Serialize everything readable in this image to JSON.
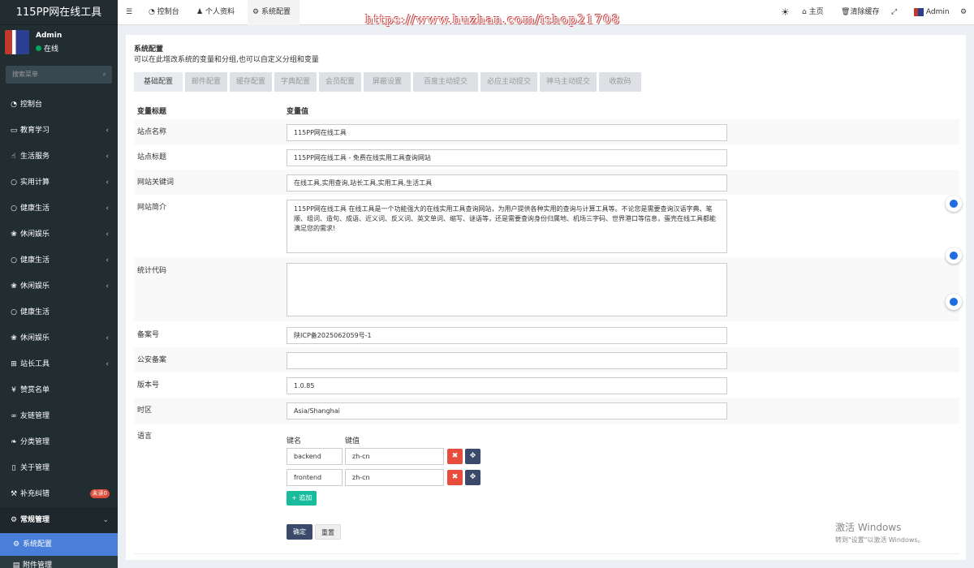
{
  "app": {
    "logo_text": "115PP网在线工具",
    "user_name": "Admin",
    "user_status": "在线"
  },
  "sidebar": {
    "search_placeholder": "搜索菜单",
    "items": [
      {
        "icon": "dashboard-icon",
        "label": "控制台",
        "chev": ""
      },
      {
        "icon": "monitor-icon",
        "label": "教育学习",
        "chev": "‹"
      },
      {
        "icon": "hand-icon",
        "label": "生活服务",
        "chev": "‹"
      },
      {
        "icon": "circle-icon",
        "label": "实用计算",
        "chev": "‹"
      },
      {
        "icon": "circle-icon",
        "label": "健康生活",
        "chev": "‹"
      },
      {
        "icon": "paw-icon",
        "label": "休闲娱乐",
        "chev": "‹"
      },
      {
        "icon": "circle-icon",
        "label": "健康生活",
        "chev": "‹"
      },
      {
        "icon": "paw-icon",
        "label": "休闲娱乐",
        "chev": "‹"
      },
      {
        "icon": "circle-icon",
        "label": "健康生活",
        "chev": ""
      },
      {
        "icon": "paw-icon",
        "label": "休闲娱乐",
        "chev": "‹"
      },
      {
        "icon": "sitemap-icon",
        "label": "站长工具",
        "chev": "‹"
      },
      {
        "icon": "yen-icon",
        "label": "赞赏名单",
        "chev": ""
      },
      {
        "icon": "link-icon",
        "label": "友链管理",
        "chev": ""
      },
      {
        "icon": "leaf-icon",
        "label": "分类管理",
        "chev": ""
      },
      {
        "icon": "file-icon",
        "label": "关于管理",
        "chev": ""
      },
      {
        "icon": "tools-icon",
        "label": "补充纠错",
        "chev": "",
        "badge": "未读0"
      }
    ],
    "group": {
      "label": "常规管理",
      "chev": "⌄"
    },
    "active_sub": "系统配置",
    "next_sub": "附件管理"
  },
  "topbar": {
    "tabs": [
      "控制台",
      "个人资料",
      "系统配置"
    ],
    "right": [
      "主页",
      "清除缓存",
      "Admin"
    ],
    "watermark": "https://www.huzhan.com/ishop21708"
  },
  "page": {
    "title": "系统配置",
    "subtitle": "可以在此增改系统的变量和分组,也可以自定义分组和变量",
    "tabs": [
      "基础配置",
      "邮件配置",
      "缓存配置",
      "字典配置",
      "会员配置",
      "屏蔽设置",
      "百度主动提交",
      "必应主动提交",
      "神马主动提交",
      "收款码"
    ]
  },
  "table": {
    "header": {
      "title": "变量标题",
      "value": "变量值"
    },
    "rows": [
      {
        "label": "站点名称",
        "value": "115PP网在线工具"
      },
      {
        "label": "站点标题",
        "value": "115PP网在线工具 - 免费在线实用工具查询网站"
      },
      {
        "label": "网站关键词",
        "value": "在线工具,实用查询,站长工具,实用工具,生活工具"
      },
      {
        "label": "网站简介",
        "value": "115PP网在线工具 在线工具是一个功能强大的在线实用工具查询网站，为用户提供各种实用的查询与计算工具等。不论您是需要查询汉语字典、笔顺、组词、造句、成语、近义词、反义词、英文单词、缩写、谜语等，还是需要查询身份归属地、机场三字码、世界港口等信息，蛋壳在线工具都能满足您的需求!"
      },
      {
        "label": "统计代码",
        "value": ""
      },
      {
        "label": "备案号",
        "value": "陕ICP备2025062059号-1"
      },
      {
        "label": "公安备案",
        "value": ""
      },
      {
        "label": "版本号",
        "value": "1.0.85"
      },
      {
        "label": "时区",
        "value": "Asia/Shanghai"
      },
      {
        "label": "语言",
        "value": ""
      }
    ],
    "lang": {
      "key_header": "键名",
      "value_header": "键值",
      "pairs": [
        {
          "k": "backend",
          "v": "zh-cn"
        },
        {
          "k": "frontend",
          "v": "zh-cn"
        }
      ],
      "add_label": "+ 追加"
    }
  },
  "buttons": {
    "ok": "确定",
    "reset": "重置"
  },
  "windows": {
    "line1": "激活 Windows",
    "line2": "转到\"设置\"以激活 Windows。"
  },
  "colors": {
    "sidebar": "#222d32",
    "active": "#4a7fd9",
    "accent_green": "#18bc9c",
    "danger": "#e74c3c"
  }
}
